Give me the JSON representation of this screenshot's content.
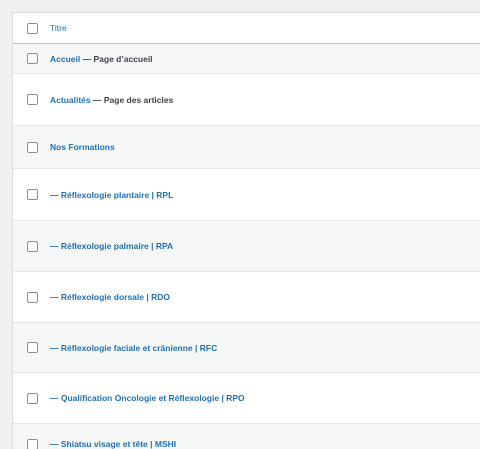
{
  "table": {
    "header": {
      "title_label": "Titre"
    },
    "rows": [
      {
        "title": "Accueil",
        "state": "— Page d’accueil"
      },
      {
        "title": "Actualités",
        "state": "— Page des articles"
      },
      {
        "title": "Nos Formations",
        "state": ""
      },
      {
        "title": "— Réflexologie plantaire | RPL",
        "state": ""
      },
      {
        "title": "— Réflexologie palmaire | RPA",
        "state": ""
      },
      {
        "title": "— Réflexologie dorsale | RDO",
        "state": ""
      },
      {
        "title": "— Réflexologie faciale et crânienne | RFC",
        "state": ""
      },
      {
        "title": "— Qualification Oncologie et Réflexologie | RPO",
        "state": ""
      },
      {
        "title": "— Shiatsu visage et tête | MSHI",
        "state": ""
      }
    ]
  }
}
